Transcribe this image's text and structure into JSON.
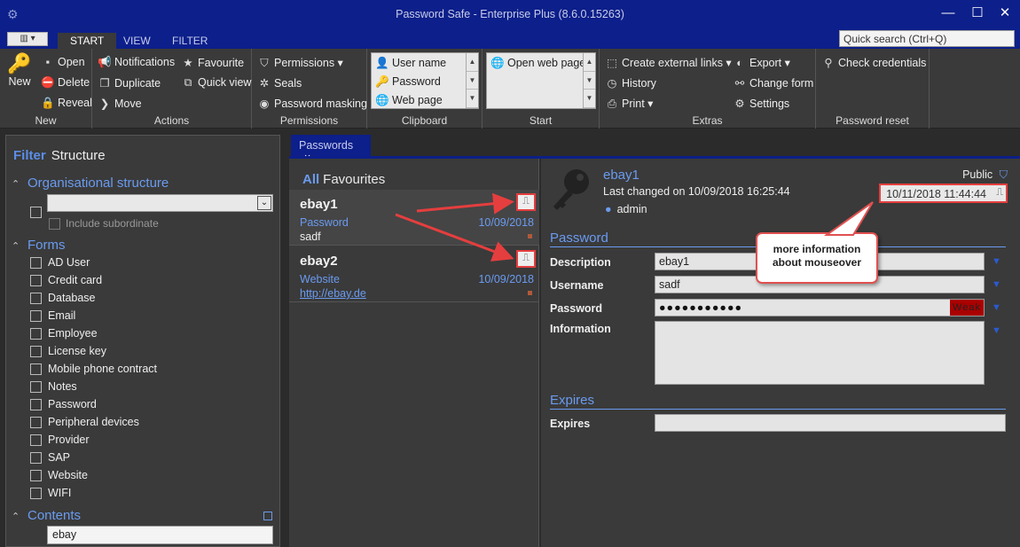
{
  "window": {
    "title": "Password Safe - Enterprise Plus (8.6.0.15263)"
  },
  "tabs": [
    {
      "label": "START"
    },
    {
      "label": "VIEW"
    },
    {
      "label": "FILTER"
    }
  ],
  "quicksearch": {
    "placeholder": "Quick search (Ctrl+Q)"
  },
  "ribbon": {
    "new": {
      "label": "New",
      "group": "New"
    },
    "actions": {
      "items": [
        "Open",
        "Delete",
        "Reveal",
        "Notifications",
        "Duplicate",
        "Move",
        "Favourite",
        "Quick view"
      ],
      "group": "Actions"
    },
    "permissions": {
      "items": [
        "Permissions",
        "Seals",
        "Password masking"
      ],
      "group": "Permissions"
    },
    "clipboard": {
      "items": [
        "User name",
        "Password",
        "Web page"
      ],
      "group": "Clipboard"
    },
    "start": {
      "items": [
        "Open web page"
      ],
      "group": "Start"
    },
    "extras": {
      "items": [
        "Create external links",
        "History",
        "Print",
        "Export",
        "Change form",
        "Settings"
      ],
      "group": "Extras"
    },
    "reset": {
      "items": [
        "Check credentials"
      ],
      "group": "Password reset"
    }
  },
  "filter": {
    "header_filter": "Filter",
    "header_structure": "Structure",
    "org_section": "Organisational structure",
    "include_subordinate": "Include subordinate",
    "forms_section": "Forms",
    "forms": [
      "AD User",
      "Credit card",
      "Database",
      "Email",
      "Employee",
      "License key",
      "Mobile phone contract",
      "Notes",
      "Password",
      "Peripheral devices",
      "Provider",
      "SAP",
      "Website",
      "WIFI"
    ],
    "contents_section": "Contents",
    "contents_value": "ebay"
  },
  "doctab": {
    "label": "Passwords",
    "close": "×"
  },
  "list": {
    "header_all": "All",
    "header_fav": "Favourites",
    "entries": [
      {
        "name": "ebay1",
        "type": "Password",
        "date": "10/09/2018",
        "sub": "sadf"
      },
      {
        "name": "ebay2",
        "type": "Website",
        "date": "10/09/2018",
        "sub": "http://ebay.de"
      }
    ]
  },
  "detail": {
    "name": "ebay1",
    "last_changed": "Last changed on 10/09/2018 16:25:44",
    "user": "admin",
    "visibility": "Public",
    "timestamp": "10/11/2018 11:44:44",
    "password_section": "Password",
    "fields": [
      {
        "label": "Description",
        "value": "ebay1"
      },
      {
        "label": "Username",
        "value": "sadf"
      },
      {
        "label": "Password",
        "value": "●●●●●●●●●●●",
        "strength": "Weak"
      },
      {
        "label": "Information",
        "value": ""
      }
    ],
    "expires_section": "Expires",
    "expires_label": "Expires",
    "expires_value": ""
  },
  "callout": {
    "line1": "more information",
    "line2": "about mouseover"
  }
}
